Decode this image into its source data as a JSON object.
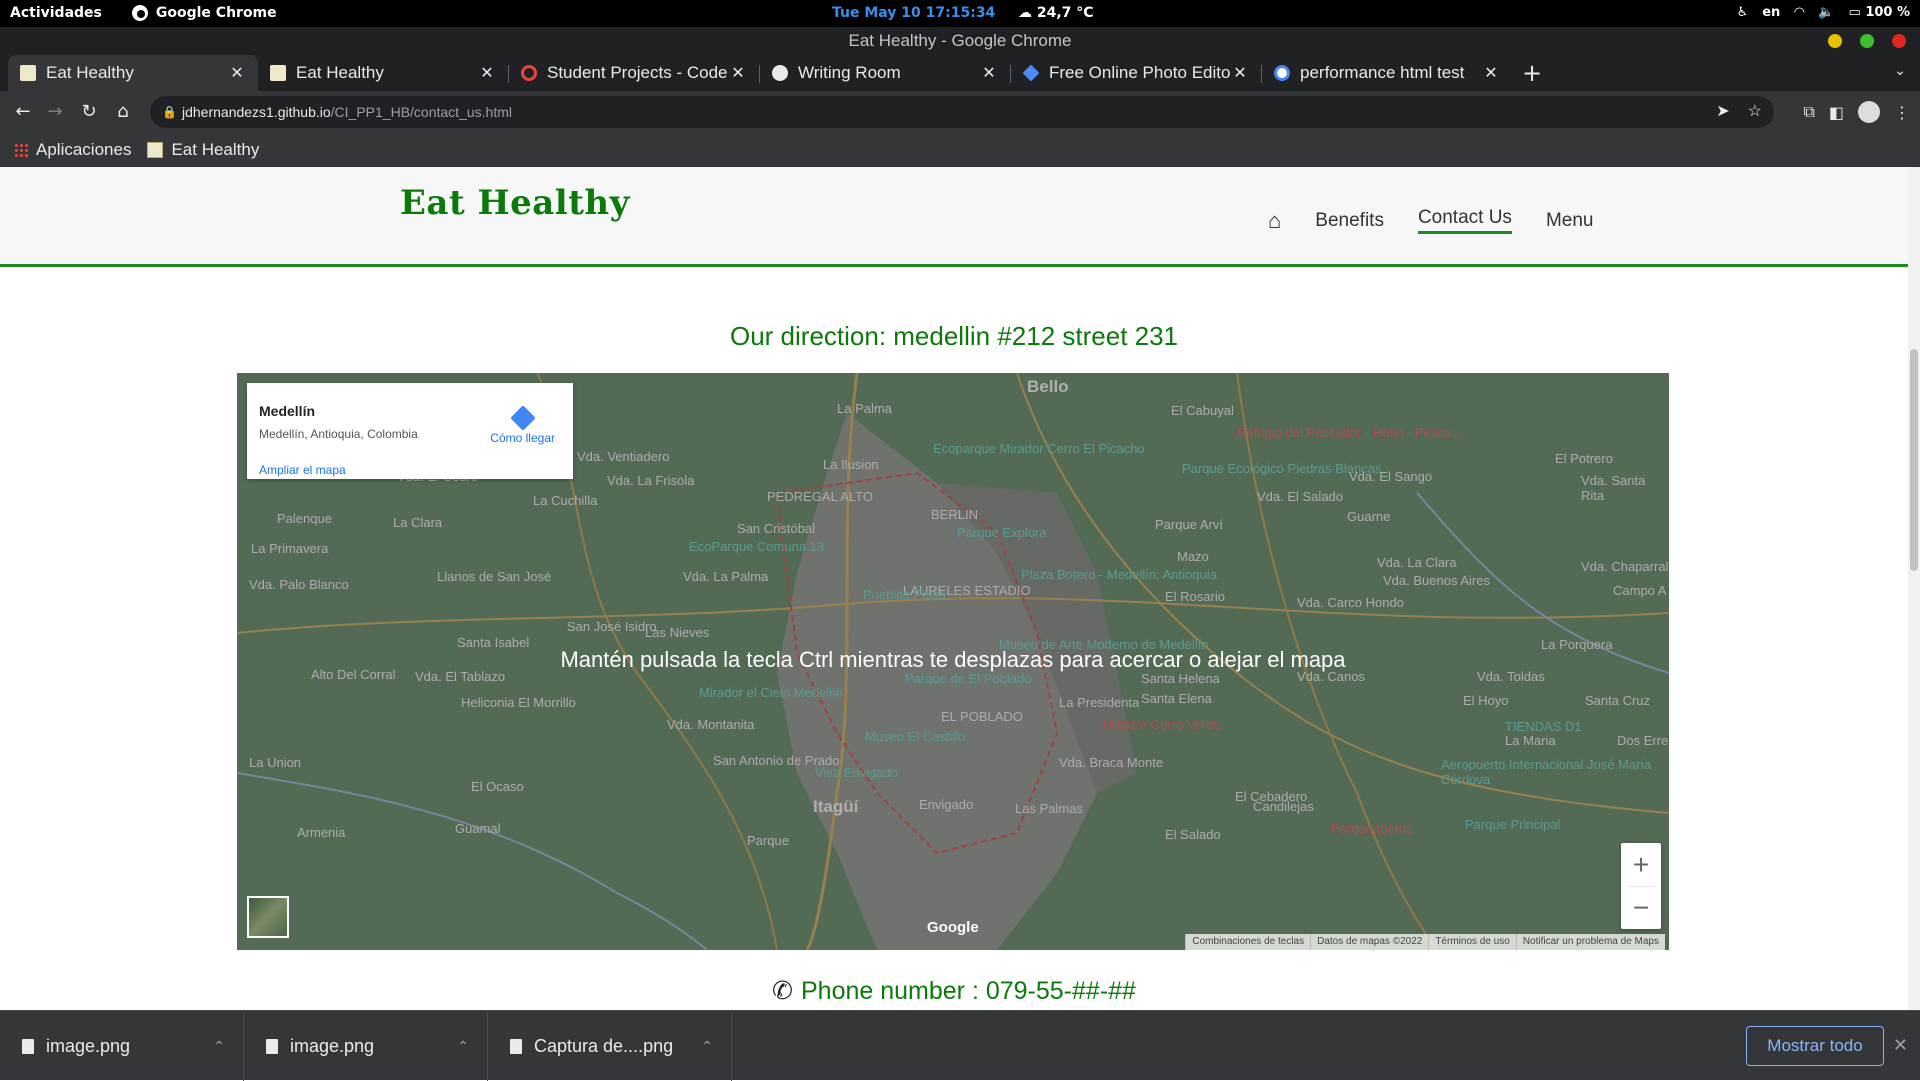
{
  "system_bar": {
    "activities": "Actividades",
    "app_name": "Google Chrome",
    "clock": "Tue May 10  17:15:34",
    "weather": "24,7 °C",
    "lang": "en",
    "battery": "100 %"
  },
  "window": {
    "title": "Eat Healthy - Google Chrome"
  },
  "tabs": [
    {
      "title": "Eat Healthy",
      "favicon_color": "#efe7c9",
      "active": true
    },
    {
      "title": "Eat Healthy",
      "favicon_color": "#efe7c9",
      "active": false
    },
    {
      "title": "Student Projects - Code",
      "favicon_color": "#e8453c",
      "active": false
    },
    {
      "title": "Writing Room",
      "favicon_color": "#e8eaed",
      "active": false
    },
    {
      "title": "Free Online Photo Editor",
      "favicon_color": "#4c8bf5",
      "active": false
    },
    {
      "title": "performance html test",
      "favicon_color": "#ffffff",
      "active": false
    }
  ],
  "address_bar": {
    "host": "jdhernandezs1.github.io",
    "path": "/CI_PP1_HB/contact_us.html"
  },
  "bookmarks": {
    "apps": "Aplicaciones",
    "items": [
      "Eat Healthy"
    ]
  },
  "site": {
    "logo": "Eat Healthy",
    "nav": [
      "Benefits",
      "Contact Us",
      "Menu"
    ],
    "active_nav": "Contact Us",
    "direction": "Our direction: medellin #212 street 231",
    "phone": "Phone number : 079-55-##-##"
  },
  "map": {
    "place_name": "Medellín",
    "place_address": "Medellín, Antioquia, Colombia",
    "directions_label": "Cómo llegar",
    "enlarge_label": "Ampliar el mapa",
    "ctrl_hint": "Mantén pulsada la tecla Ctrl mientras te desplazas para acercar o alejar el mapa",
    "zoom_in": "+",
    "zoom_out": "−",
    "google": "Google",
    "attribution": [
      "Combinaciones de teclas",
      "Datos de mapas ©2022",
      "Términos de uso",
      "Notificar un problema de Maps"
    ],
    "labels": [
      {
        "t": "Bello",
        "c": "big"
      },
      {
        "t": "La Palma",
        "c": ""
      },
      {
        "t": "El Cabuyal",
        "c": ""
      },
      {
        "t": "Ecoparque Mirador Cerro El Picacho",
        "c": "poi"
      },
      {
        "t": "Refugio del Pescador - Hotel - Pesca...",
        "c": "red"
      },
      {
        "t": "Parque Ecológico Piedras Blancas",
        "c": "poi"
      },
      {
        "t": "Vda. El Sango",
        "c": ""
      },
      {
        "t": "Vda. El Salado",
        "c": ""
      },
      {
        "t": "El Potrero",
        "c": ""
      },
      {
        "t": "Vda. Santa Rita",
        "c": ""
      },
      {
        "t": "Vda. Ventiadero",
        "c": ""
      },
      {
        "t": "Vda. La Frisola",
        "c": ""
      },
      {
        "t": "La Ilusion",
        "c": ""
      },
      {
        "t": "Vda. El Cedro",
        "c": ""
      },
      {
        "t": "La Cuchilla",
        "c": ""
      },
      {
        "t": "PEDREGAL ALTO",
        "c": ""
      },
      {
        "t": "BERLIN",
        "c": ""
      },
      {
        "t": "Parque Explora",
        "c": "poi"
      },
      {
        "t": "Parque Arví",
        "c": ""
      },
      {
        "t": "Guarne",
        "c": ""
      },
      {
        "t": "Palenque",
        "c": ""
      },
      {
        "t": "La Clara",
        "c": ""
      },
      {
        "t": "San Cristóbal",
        "c": ""
      },
      {
        "t": "EcoParque Comuna 13",
        "c": "poi"
      },
      {
        "t": "La Primavera",
        "c": ""
      },
      {
        "t": "Mazo",
        "c": ""
      },
      {
        "t": "Vda. La Clara",
        "c": ""
      },
      {
        "t": "Vda. Chaparral",
        "c": ""
      },
      {
        "t": "Plaza Botero - Medellín, Antioquia",
        "c": "poi"
      },
      {
        "t": "Llanos de San José",
        "c": ""
      },
      {
        "t": "Vda. Palo Blanco",
        "c": ""
      },
      {
        "t": "Vda. La Palma",
        "c": ""
      },
      {
        "t": "LAURELES ESTADIO",
        "c": ""
      },
      {
        "t": "El Rosario",
        "c": ""
      },
      {
        "t": "Vda. Buenos Aires",
        "c": ""
      },
      {
        "t": "Campo A",
        "c": ""
      },
      {
        "t": "Pueblito Paisa",
        "c": "poi"
      },
      {
        "t": "San José Isidro",
        "c": ""
      },
      {
        "t": "Las Nieves",
        "c": ""
      },
      {
        "t": "Vda. Carco Hondo",
        "c": ""
      },
      {
        "t": "Santa Isabel",
        "c": ""
      },
      {
        "t": "Museo de Arte Moderno de Medellín",
        "c": "poi"
      },
      {
        "t": "La Porquera",
        "c": ""
      },
      {
        "t": "Alto Del Corral",
        "c": ""
      },
      {
        "t": "Vda. El Tablazo",
        "c": ""
      },
      {
        "t": "Santa Helena",
        "c": ""
      },
      {
        "t": "Vda. Canos",
        "c": ""
      },
      {
        "t": "Vda. Toldas",
        "c": ""
      },
      {
        "t": "Parque de El Poblado",
        "c": "poi"
      },
      {
        "t": "Mirador el Cielo Medellín",
        "c": "poi"
      },
      {
        "t": "Heliconia El Morrillo",
        "c": ""
      },
      {
        "t": "La Presidenta",
        "c": ""
      },
      {
        "t": "Santa Elena",
        "c": ""
      },
      {
        "t": "El Hoyo",
        "c": ""
      },
      {
        "t": "Santa Cruz",
        "c": ""
      },
      {
        "t": "EL POBLADO",
        "c": ""
      },
      {
        "t": "Mirador Cerro Verde",
        "c": "red"
      },
      {
        "t": "TIENDAS D1",
        "c": "poi"
      },
      {
        "t": "Vda. Montanita",
        "c": ""
      },
      {
        "t": "Museo El Castillo",
        "c": "poi"
      },
      {
        "t": "La Maria",
        "c": ""
      },
      {
        "t": "Dos Erre",
        "c": ""
      },
      {
        "t": "La Union",
        "c": ""
      },
      {
        "t": "San Antonio de Prado",
        "c": ""
      },
      {
        "t": "Viva Envigado",
        "c": "poi"
      },
      {
        "t": "Vda. Braca Monte",
        "c": ""
      },
      {
        "t": "Aeropuerto Internacional José María Córdova",
        "c": "poi"
      },
      {
        "t": "El Ocaso",
        "c": ""
      },
      {
        "t": "El Cebadero",
        "c": ""
      },
      {
        "t": "Itagüí",
        "c": "big"
      },
      {
        "t": "Envigado",
        "c": ""
      },
      {
        "t": "Las Palmas",
        "c": ""
      },
      {
        "t": "Candilejas",
        "c": ""
      },
      {
        "t": "Guamal",
        "c": ""
      },
      {
        "t": "Armenia",
        "c": ""
      },
      {
        "t": "Parqueaderos",
        "c": "red"
      },
      {
        "t": "Parque Principal",
        "c": "poi"
      },
      {
        "t": "El Salado",
        "c": ""
      },
      {
        "t": "Parque",
        "c": ""
      }
    ]
  },
  "downloads": {
    "items": [
      "image.png",
      "image.png",
      "Captura de....png"
    ],
    "show_all": "Mostrar todo"
  }
}
